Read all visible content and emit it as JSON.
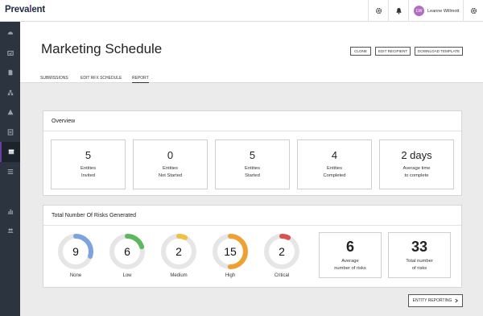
{
  "app": {
    "logo_prefix": "Preva",
    "logo_accent": "l",
    "logo_suffix": "ent"
  },
  "user": {
    "initials": "LW",
    "name": "Leanne Willmott",
    "avatar_color": "#b26cc2"
  },
  "header": {
    "title": "Marketing Schedule",
    "buttons": {
      "clone": "CLONE",
      "edit_recipient": "EDIT RECIPIENT",
      "download_template": "DOWNLOAD TEMPLATE"
    },
    "tabs": {
      "submissions": "SUBMISSIONS",
      "edit_rfx": "EDIT RFX SCHEDULE",
      "report": "REPORT"
    },
    "active_tab": "REPORT"
  },
  "overview": {
    "title": "Overview",
    "stats": [
      {
        "value": "5",
        "line1": "Entities",
        "line2": "Invited"
      },
      {
        "value": "0",
        "line1": "Entities",
        "line2": "Not Started"
      },
      {
        "value": "5",
        "line1": "Entities",
        "line2": "Started"
      },
      {
        "value": "4",
        "line1": "Entities",
        "line2": "Completed"
      },
      {
        "value": "2 days",
        "line1": "Average time",
        "line2": "to complete"
      }
    ]
  },
  "risks": {
    "title": "Total Number Of Risks Generated",
    "donuts": [
      {
        "value": "9",
        "label": "None",
        "color": "#7aa3e0",
        "fill": 0.3
      },
      {
        "value": "6",
        "label": "Low",
        "color": "#5cb85c",
        "fill": 0.2
      },
      {
        "value": "2",
        "label": "Medium",
        "color": "#f0c040",
        "fill": 0.07
      },
      {
        "value": "15",
        "label": "High",
        "color": "#f0a030",
        "fill": 0.5
      },
      {
        "value": "2",
        "label": "Critical",
        "color": "#d9534f",
        "fill": 0.07
      }
    ],
    "average": {
      "value": "6",
      "line1": "Average",
      "line2": "number of risks"
    },
    "total": {
      "value": "33",
      "line1": "Total number",
      "line2": "of risks"
    }
  },
  "entity_reporting_label": "ENTITY REPORTING",
  "colors": {
    "sidebar": "#2c3440",
    "accent": "#5f2d91",
    "donut_track": "#e6e6e6"
  }
}
